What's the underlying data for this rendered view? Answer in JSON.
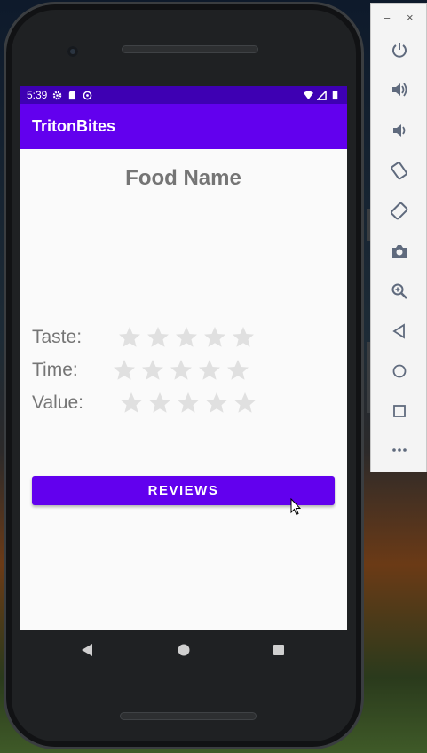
{
  "status_bar": {
    "time": "5:39"
  },
  "app_bar": {
    "title": "TritonBites"
  },
  "food": {
    "name": "Food Name"
  },
  "ratings": [
    {
      "label": "Taste:",
      "stars": 0,
      "max": 5
    },
    {
      "label": "Time:",
      "stars": 0,
      "max": 5
    },
    {
      "label": "Value:",
      "stars": 0,
      "max": 5
    }
  ],
  "reviews_button": {
    "label": "REVIEWS"
  },
  "emulator_toolbar": {
    "minimize": "–",
    "close": "×",
    "buttons": [
      "power-icon",
      "volume-up-icon",
      "volume-down-icon",
      "rotate-left-icon",
      "rotate-right-icon",
      "camera-icon",
      "zoom-icon",
      "back-icon",
      "home-icon",
      "overview-icon",
      "more-icon"
    ]
  },
  "colors": {
    "primary": "#6200ee",
    "status_bar": "#3e00b3",
    "star_empty": "#e0e0e0",
    "text_gray": "#757575"
  }
}
